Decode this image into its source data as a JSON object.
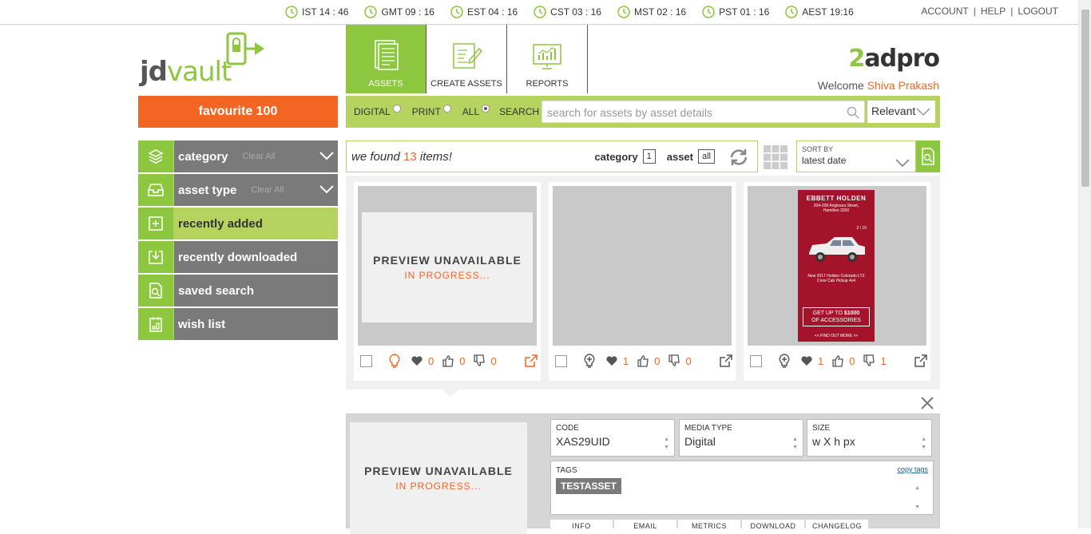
{
  "topbar": {
    "clocks": [
      {
        "label": "IST 14 : 46"
      },
      {
        "label": "GMT 09 : 16"
      },
      {
        "label": "EST 04 : 16"
      },
      {
        "label": "CST 03 : 16"
      },
      {
        "label": "MST 02 : 16"
      },
      {
        "label": "PST 01 : 16"
      },
      {
        "label": "AEST 19:16"
      }
    ],
    "account": "ACCOUNT",
    "help": "HELP",
    "logout": "LOGOUT",
    "separator": "|"
  },
  "logo": {
    "text_bold": "jd",
    "text_light": "vault"
  },
  "favourite": "favourite 100",
  "sidebar": {
    "items": [
      {
        "label": "category",
        "clear": "Clear All",
        "icon": "layers-icon"
      },
      {
        "label": "asset type",
        "clear": "Clear All",
        "icon": "tray-icon"
      },
      {
        "label": "recently added",
        "icon": "plus-square-icon"
      },
      {
        "label": "recently downloaded",
        "icon": "download-icon"
      },
      {
        "label": "saved search",
        "icon": "search-doc-icon"
      },
      {
        "label": "wish list",
        "icon": "wishlist-icon"
      }
    ]
  },
  "tabs": [
    {
      "label": "ASSETS",
      "icon": "document-list-icon"
    },
    {
      "label": "CREATE ASSETS",
      "icon": "edit-doc-icon"
    },
    {
      "label": "REPORTS",
      "icon": "chart-icon"
    }
  ],
  "brand": {
    "prefix": "2",
    "rest": "adpro"
  },
  "welcome": {
    "text": "Welcome",
    "user": "Shiva Prakash"
  },
  "search": {
    "digital": "DIGITAL",
    "print": "PRINT",
    "all": "ALL",
    "search_label": "SEARCH",
    "placeholder": "search for assets by asset details",
    "sort": "Relevant"
  },
  "found": {
    "pre": "we found",
    "count": "13",
    "post": "items!",
    "category_label": "category",
    "category_value": "1",
    "asset_label": "asset",
    "asset_value": "all"
  },
  "sortby": {
    "label": "SORT BY",
    "value": "latest date"
  },
  "cards": [
    {
      "preview": "PREVIEW UNAVAILABLE",
      "status": "IN PROGRESS...",
      "hearts": "0",
      "likes": "0",
      "dislikes": "0"
    },
    {
      "hearts": "1",
      "likes": "0",
      "dislikes": "0"
    },
    {
      "hearts": "1",
      "likes": "0",
      "dislikes": "1",
      "ad": {
        "dealer": "EBBETT HOLDEN",
        "address": "204-208 Anglesea Street, Hamilton 3200",
        "page": "2 / 10",
        "model": "New 2017 Holden Colorado LTZ Crew Cab Pickup 4x4",
        "offer1": "GET UP TO",
        "offer_amount": "$1000",
        "offer2": "OF ACCESSORIES",
        "cta": "<< FIND OUT MORE >>"
      }
    }
  ],
  "detail": {
    "preview": "PREVIEW UNAVAILABLE",
    "status": "IN PROGRESS...",
    "code_label": "CODE",
    "code_value": "XAS29UID",
    "media_label": "MEDIA TYPE",
    "media_value": "Digital",
    "size_label": "SIZE",
    "size_value": "w X h px",
    "tags_label": "TAGS",
    "copy_tags": "copy tags",
    "tag": "TESTASSET",
    "subtabs": [
      "INFO",
      "EMAIL",
      "METRICS",
      "DOWNLOAD",
      "CHANGELOG"
    ]
  },
  "colors": {
    "green": "#8dc63f",
    "lightgreen": "#b5d35e",
    "orange": "#f26522",
    "grey": "#7a7a7a"
  }
}
